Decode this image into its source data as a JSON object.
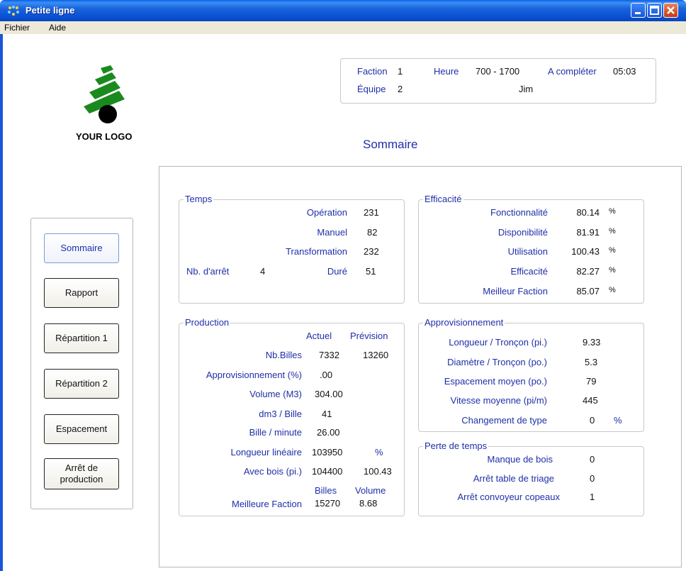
{
  "window": {
    "title": "Petite ligne"
  },
  "menu": {
    "items": [
      "Fichier",
      "Aide"
    ]
  },
  "logo": {
    "text": "YOUR LOGO"
  },
  "header": {
    "faction_label": "Faction",
    "faction_value": "1",
    "heure_label": "Heure",
    "heure_value": "700 - 1700",
    "acompleter_label": "A compléter",
    "acompleter_value": "05:03",
    "equipe_label": "Équipe",
    "equipe_value": "2",
    "equipe_name": "Jim"
  },
  "page_title": "Sommaire",
  "nav": {
    "items": [
      {
        "label": "Sommaire",
        "active": true
      },
      {
        "label": "Rapport",
        "active": false
      },
      {
        "label": "Répartition 1",
        "active": false
      },
      {
        "label": "Répartition 2",
        "active": false
      },
      {
        "label": "Espacement",
        "active": false
      },
      {
        "label": "Arrêt de production",
        "active": false
      }
    ]
  },
  "temps": {
    "title": "Temps",
    "operation_label": "Opération",
    "operation_value": "231",
    "manuel_label": "Manuel",
    "manuel_value": "82",
    "transformation_label": "Transformation",
    "transformation_value": "232",
    "nb_arret_label": "Nb. d'arrêt",
    "nb_arret_value": "4",
    "dure_label": "Duré",
    "dure_value": "51"
  },
  "efficacite": {
    "title": "Efficacité",
    "rows": [
      {
        "label": "Fonctionnalité",
        "value": "80.14",
        "unit": "%"
      },
      {
        "label": "Disponibilité",
        "value": "81.91",
        "unit": "%"
      },
      {
        "label": "Utilisation",
        "value": "100.43",
        "unit": "%"
      },
      {
        "label": "Efficacité",
        "value": "82.27",
        "unit": "%"
      },
      {
        "label": "Meilleur Faction",
        "value": "85.07",
        "unit": "%"
      }
    ]
  },
  "production": {
    "title": "Production",
    "col_actuel": "Actuel",
    "col_prevision": "Prévision",
    "rows": [
      {
        "label": "Nb.Billes",
        "actuel": "7332",
        "prevision": "13260"
      },
      {
        "label": "Approvisionnement (%)",
        "actuel": ".00",
        "prevision": ""
      },
      {
        "label": "Volume (M3)",
        "actuel": "304.00",
        "prevision": ""
      },
      {
        "label": "dm3 / Bille",
        "actuel": "41",
        "prevision": ""
      },
      {
        "label": "Bille / minute",
        "actuel": "26.00",
        "prevision": ""
      },
      {
        "label": "Longueur linéaire",
        "actuel": "103950",
        "prevision": "%"
      },
      {
        "label": "Avec bois (pi.)",
        "actuel": "104400",
        "prevision": "100.43"
      }
    ],
    "col_billes": "Billes",
    "col_volume": "Volume",
    "meilleure_label": "Meilleure Faction",
    "meilleure_billes": "15270",
    "meilleure_volume": "8.68"
  },
  "approvisionnement": {
    "title": "Approvisionnement",
    "rows": [
      {
        "label": "Longueur / Tronçon (pi.)",
        "value": "9.33",
        "unit": ""
      },
      {
        "label": "Diamètre / Tronçon (po.)",
        "value": "5.3",
        "unit": ""
      },
      {
        "label": "Espacement moyen (po.)",
        "value": "79",
        "unit": ""
      },
      {
        "label": "Vitesse moyenne (pi/m)",
        "value": "445",
        "unit": ""
      },
      {
        "label": "Changement de type",
        "value": "0",
        "unit": "%"
      }
    ]
  },
  "perte_temps": {
    "title": "Perte de temps",
    "rows": [
      {
        "label": "Manque de bois",
        "value": "0"
      },
      {
        "label": "Arrêt table de triage",
        "value": "0"
      },
      {
        "label": "Arrêt convoyeur copeaux",
        "value": "1"
      }
    ]
  },
  "colors": {
    "label_blue": "#1f2fa8",
    "titlebar_blue": "#0a4fd4",
    "logo_green": "#1a8a1e"
  }
}
